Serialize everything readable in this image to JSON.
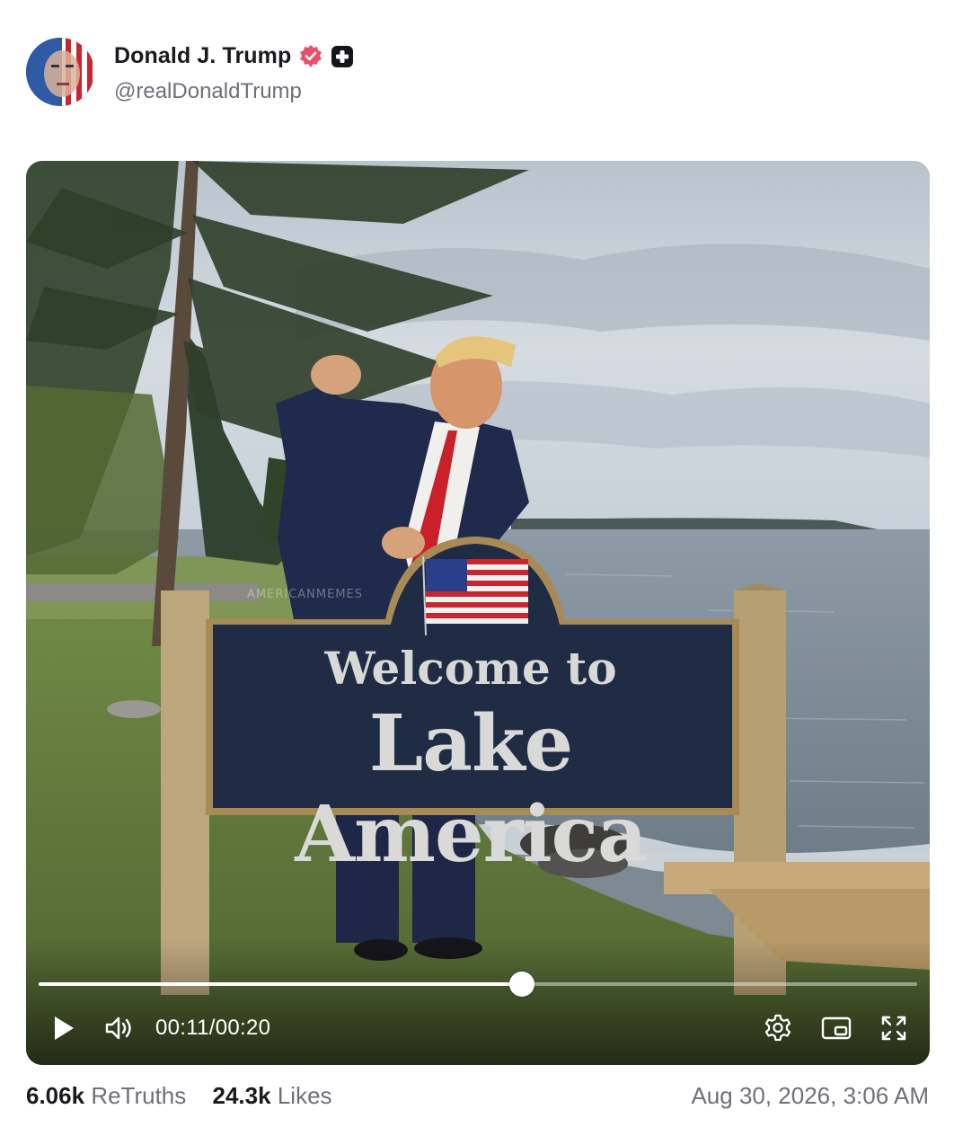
{
  "author": {
    "name": "Donald J. Trump",
    "handle": "@realDonaldTrump",
    "verified_icon": "verified-badge-icon",
    "plus_icon": "plus-badge-icon",
    "verified_color": "#e8506c"
  },
  "video": {
    "sign_line1": "Welcome to",
    "sign_line2": "Lake America",
    "watermark": "AMERICANMEMES",
    "current_time": "00:11",
    "separator": "/",
    "duration": "00:20",
    "progress_fraction": 0.55,
    "controls": [
      "play-icon",
      "volume-icon",
      "settings-icon",
      "picture-in-picture-icon",
      "fullscreen-icon"
    ]
  },
  "stats": {
    "retruths_count": "6.06k",
    "retruths_label": "ReTruths",
    "likes_count": "24.3k",
    "likes_label": "Likes",
    "timestamp": "Aug 30, 2026, 3:06 AM"
  }
}
